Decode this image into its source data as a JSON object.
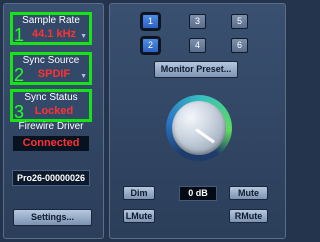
{
  "status": {
    "sample_rate": {
      "number": "1",
      "title": "Sample Rate",
      "value": "44.1 kHz"
    },
    "sync_source": {
      "number": "2",
      "title": "Sync Source",
      "value": "SPDIF"
    },
    "sync_status": {
      "number": "3",
      "title": "Sync Status",
      "value": "Locked"
    }
  },
  "firewire": {
    "title": "Firewire Driver",
    "value": "Connected"
  },
  "device": {
    "serial": "Pro26-00000026"
  },
  "settings_label": "Settings...",
  "monitor": {
    "buttons": [
      "1",
      "2",
      "3",
      "4",
      "5",
      "6"
    ],
    "active": [
      "1",
      "2"
    ],
    "preset_label": "Monitor Preset..."
  },
  "volume": {
    "level": "0 dB",
    "dim_label": "Dim",
    "mute_label": "Mute",
    "lmute_label": "LMute",
    "rmute_label": "RMute"
  },
  "colors": {
    "background": "#24344c",
    "highlight_border": "#17e317",
    "status_value": "#ff3232",
    "active_button": "#2c62c0"
  }
}
